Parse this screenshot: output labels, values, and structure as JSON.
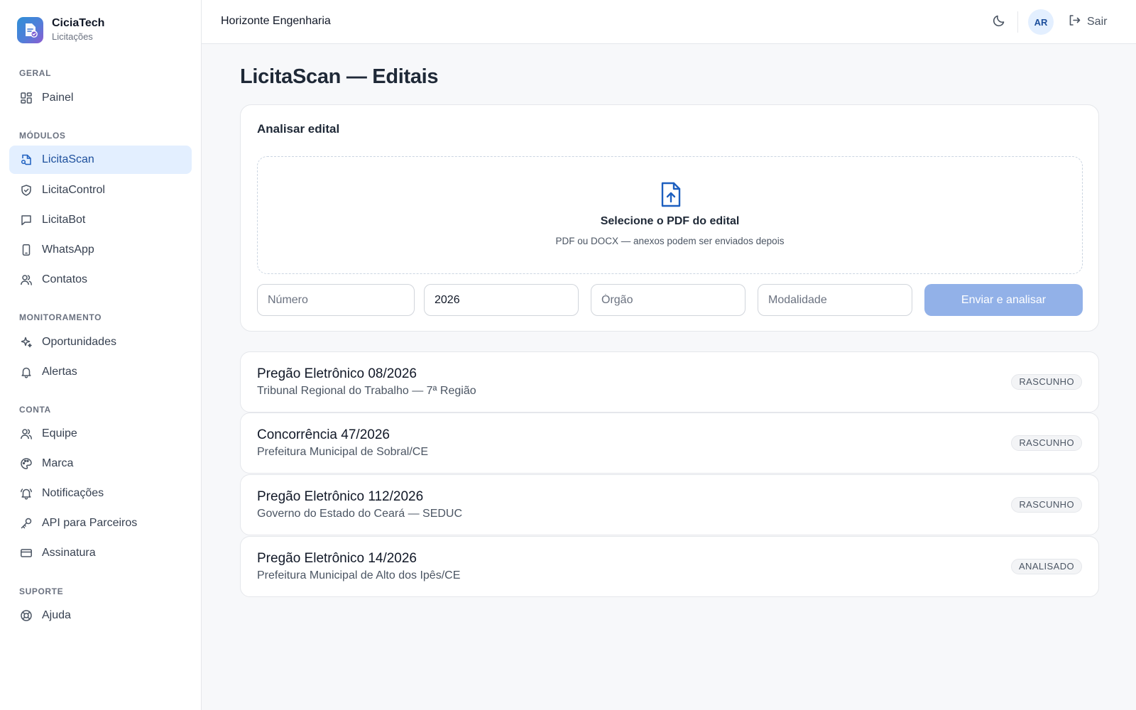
{
  "brand": {
    "name": "CiciaTech",
    "subtitle": "Licitações"
  },
  "sidebar": {
    "sections": {
      "geral": "GERAL",
      "modulos": "MÓDULOS",
      "monitoramento": "MONITORAMENTO",
      "conta": "CONTA",
      "suporte": "SUPORTE"
    },
    "items": {
      "painel": "Painel",
      "licitascan": "LicitaScan",
      "licitacontrol": "LicitaControl",
      "licitabot": "LicitaBot",
      "whatsapp": "WhatsApp",
      "contatos": "Contatos",
      "oportunidades": "Oportunidades",
      "alertas": "Alertas",
      "equipe": "Equipe",
      "marca": "Marca",
      "notificacoes": "Notificações",
      "api": "API para Parceiros",
      "assinatura": "Assinatura",
      "ajuda": "Ajuda"
    },
    "active": "LicitaScan"
  },
  "topbar": {
    "company": "Horizonte Engenharia",
    "avatar_initials": "AR",
    "logout_label": "Sair"
  },
  "page": {
    "title": "LicitaScan — Editais"
  },
  "upload": {
    "card_title": "Analisar edital",
    "dropzone_title": "Selecione o PDF do edital",
    "dropzone_subtitle": "PDF ou DOCX — anexos podem ser enviados depois",
    "fields": {
      "numero_placeholder": "Número",
      "ano_value": "2026",
      "orgao_placeholder": "Órgão",
      "modalidade_placeholder": "Modalidade"
    },
    "submit_label": "Enviar e analisar"
  },
  "editais": [
    {
      "title": "Pregão Eletrônico 08/2026",
      "agency": "Tribunal Regional do Trabalho — 7ª Região",
      "status": "RASCUNHO"
    },
    {
      "title": "Concorrência 47/2026",
      "agency": "Prefeitura Municipal de Sobral/CE",
      "status": "RASCUNHO"
    },
    {
      "title": "Pregão Eletrônico 112/2026",
      "agency": "Governo do Estado do Ceará — SEDUC",
      "status": "RASCUNHO"
    },
    {
      "title": "Pregão Eletrônico 14/2026",
      "agency": "Prefeitura Municipal de Alto dos Ipês/CE",
      "status": "ANALISADO"
    }
  ],
  "colors": {
    "accent": "#1d5fbf",
    "active_bg": "#e3efff",
    "submit_disabled": "#92b1e8"
  }
}
